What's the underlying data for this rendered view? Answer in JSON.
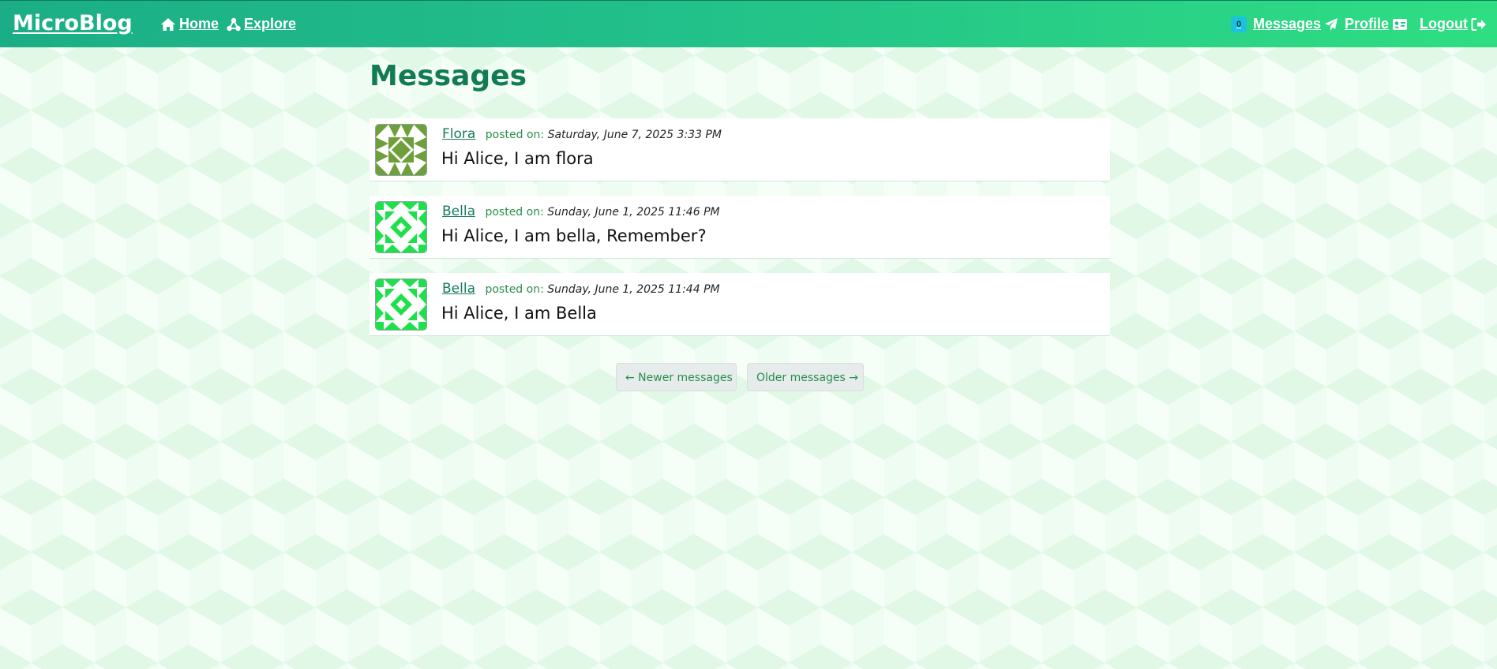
{
  "navbar": {
    "brand": "MicroBlog",
    "home_label": "Home",
    "explore_label": "Explore",
    "messages_badge": "0",
    "messages_label": "Messages",
    "profile_label": "Profile",
    "logout_label": "Logout"
  },
  "page": {
    "title": "Messages"
  },
  "messages": [
    {
      "author": "Flora",
      "posted_label": "posted on:",
      "timestamp": "Saturday, June 7, 2025 3:33 PM",
      "body": "Hi Alice, I am flora",
      "avatar_color": "#6e9f3a"
    },
    {
      "author": "Bella",
      "posted_label": "posted on:",
      "timestamp": "Sunday, June 1, 2025 11:46 PM",
      "body": "Hi Alice, I am bella, Remember?",
      "avatar_color": "#1ee04a"
    },
    {
      "author": "Bella",
      "posted_label": "posted on:",
      "timestamp": "Sunday, June 1, 2025 11:44 PM",
      "body": "Hi Alice, I am Bella",
      "avatar_color": "#1ee04a"
    }
  ],
  "pagination": {
    "newer_label": "← Newer messages",
    "older_label": "Older messages →"
  },
  "colors": {
    "navbar_start": "#1bae86",
    "navbar_end": "#2fde82",
    "title": "#127a55",
    "badge": "#19c3df"
  },
  "icons": {
    "home": "home-icon",
    "explore": "explore-icon",
    "messages": "paper-plane-icon",
    "profile": "id-card-icon",
    "logout": "logout-icon"
  }
}
